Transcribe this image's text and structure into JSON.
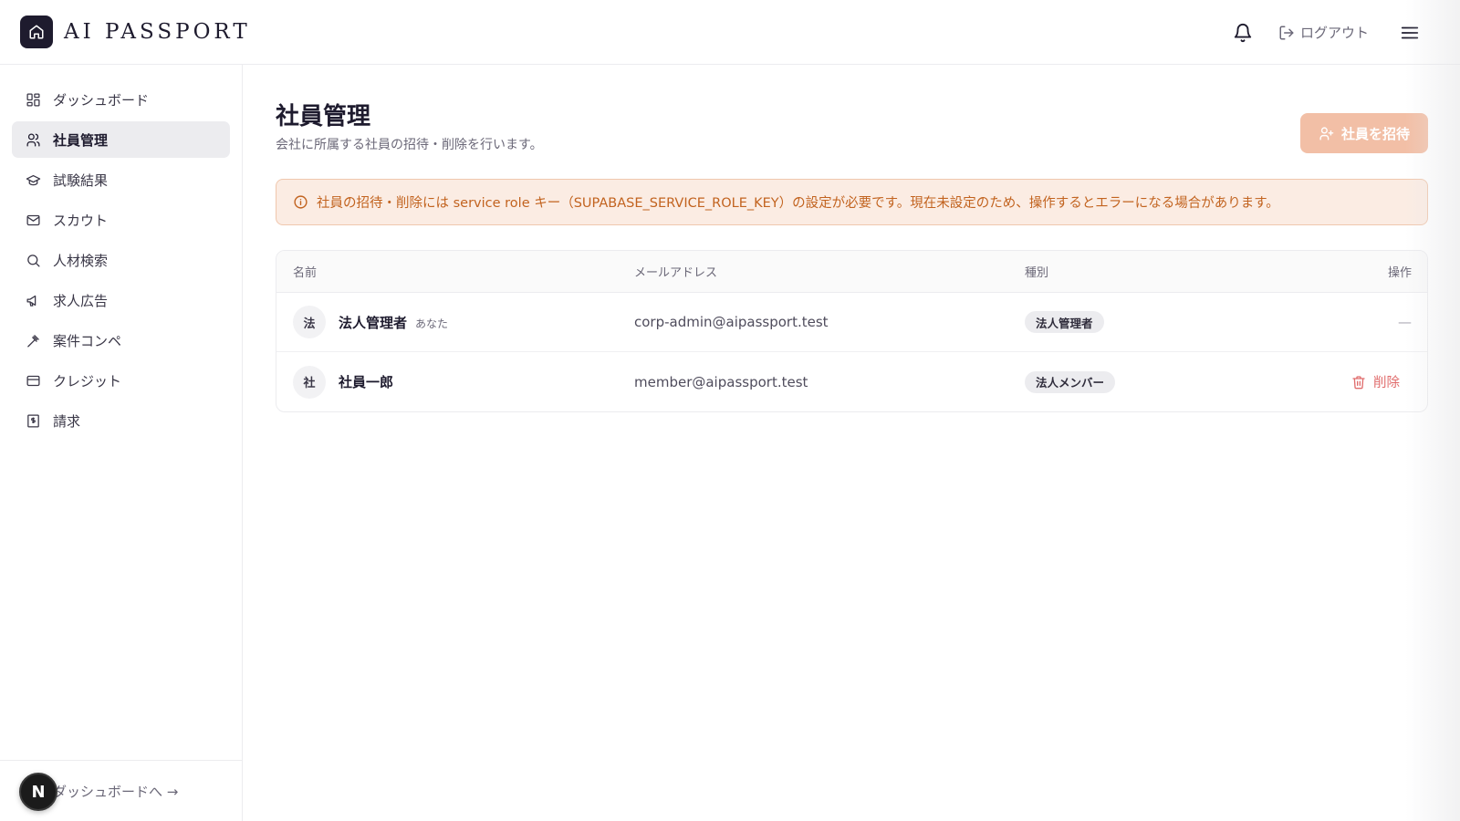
{
  "header": {
    "logo_text": "AI PASSPORT",
    "logout_label": "ログアウト"
  },
  "sidebar": {
    "items": [
      {
        "label": "ダッシュボード",
        "icon": "dashboard-icon",
        "active": false
      },
      {
        "label": "社員管理",
        "icon": "users-icon",
        "active": true
      },
      {
        "label": "試験結果",
        "icon": "graduation-cap-icon",
        "active": false
      },
      {
        "label": "スカウト",
        "icon": "mail-icon",
        "active": false
      },
      {
        "label": "人材検索",
        "icon": "search-icon",
        "active": false
      },
      {
        "label": "求人広告",
        "icon": "megaphone-icon",
        "active": false
      },
      {
        "label": "案件コンペ",
        "icon": "gavel-icon",
        "active": false
      },
      {
        "label": "クレジット",
        "icon": "credit-card-icon",
        "active": false
      },
      {
        "label": "請求",
        "icon": "receipt-icon",
        "active": false
      }
    ],
    "footer_link": "ダッシュボードへ →",
    "badge_letter": "N"
  },
  "main": {
    "title": "社員管理",
    "subtitle": "会社に所属する社員の招待・削除を行います。",
    "invite_button": "社員を招待",
    "alert": "社員の招待・削除には service role キー（SUPABASE_SERVICE_ROLE_KEY）の設定が必要です。現在未設定のため、操作するとエラーになる場合があります。",
    "table": {
      "headers": {
        "name": "名前",
        "email": "メールアドレス",
        "type": "種別",
        "action": "操作"
      },
      "rows": [
        {
          "avatar": "法",
          "name": "法人管理者",
          "you": "あなた",
          "email": "corp-admin@aipassport.test",
          "type": "法人管理者",
          "action": "—"
        },
        {
          "avatar": "社",
          "name": "社員一郎",
          "you": "",
          "email": "member@aipassport.test",
          "type": "法人メンバー",
          "action": "削除"
        }
      ]
    }
  },
  "colors": {
    "brand_dark": "#1e1b2e",
    "accent_button": "#f2bfa6",
    "alert_text": "#c2631f",
    "alert_bg": "#fbece3",
    "delete": "#e06c6c"
  }
}
